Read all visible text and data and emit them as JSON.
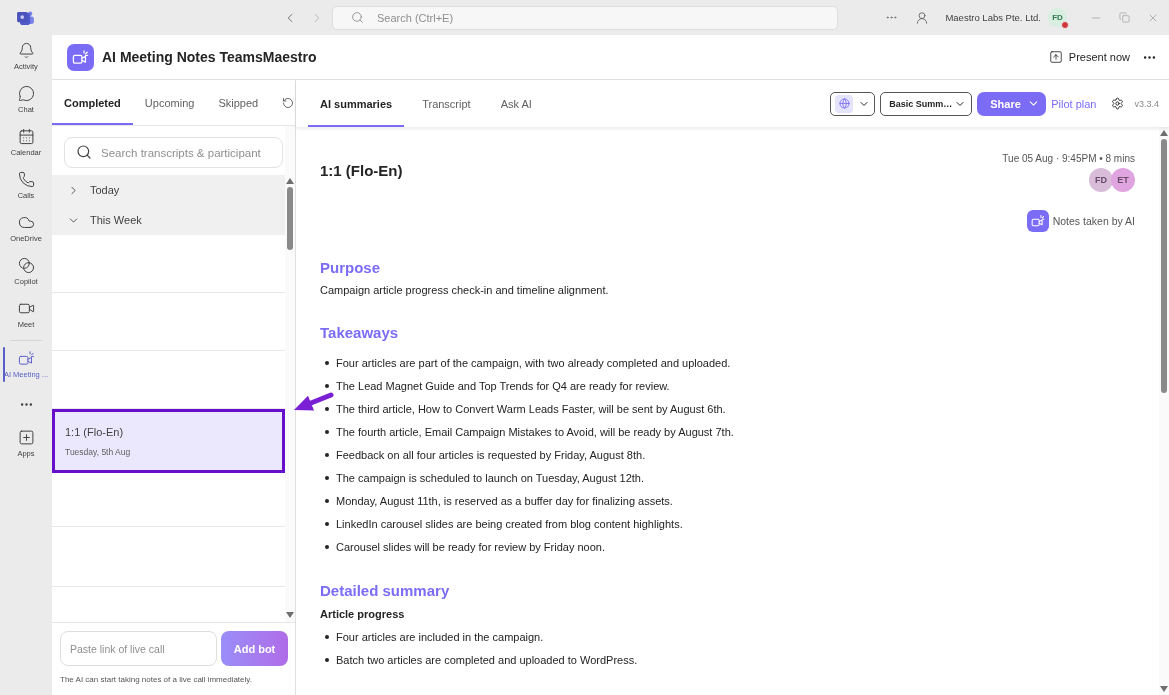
{
  "title_bar": {
    "search": {
      "placeholder": "Search (Ctrl+E)"
    },
    "organization": "Maestro Labs Pte. Ltd.",
    "user": {
      "initials": "FD"
    }
  },
  "rail": {
    "items": [
      {
        "label": "Activity",
        "selected": false
      },
      {
        "label": "Chat",
        "selected": false
      },
      {
        "label": "Calendar",
        "selected": false
      },
      {
        "label": "Calls",
        "selected": false
      },
      {
        "label": "OneDrive",
        "selected": false
      },
      {
        "label": "Copilot",
        "selected": false
      },
      {
        "label": "Meet",
        "selected": false
      },
      {
        "label": "AI Meeting ...",
        "selected": true
      }
    ],
    "apps": {
      "label": "Apps"
    }
  },
  "header": {
    "title": "AI Meeting Notes TeamsMaestro",
    "present_button": "Present now"
  },
  "left_panel": {
    "tabs": [
      {
        "label": "Completed",
        "selected": true
      },
      {
        "label": "Upcoming",
        "selected": false
      },
      {
        "label": "Skipped",
        "selected": false
      }
    ],
    "search": {
      "placeholder": "Search transcripts & participant"
    },
    "groups": [
      {
        "label": "Today",
        "expanded": false
      },
      {
        "label": "This Week",
        "expanded": true
      }
    ],
    "meetings": [
      {
        "title": "1:1 (Flo-En)",
        "date": "Tuesday, 5th Aug",
        "selected": true
      }
    ],
    "live_call": {
      "placeholder": "Paste link of live call",
      "button": "Add bot",
      "hint": "The AI can start taking notes of a live call immediately."
    }
  },
  "content": {
    "tabs": [
      {
        "label": "AI summaries",
        "selected": true
      },
      {
        "label": "Transcript",
        "selected": false
      },
      {
        "label": "Ask AI",
        "selected": false
      }
    ],
    "toolbar": {
      "template": "Basic Summ…",
      "share": "Share",
      "plan_link": "Pilot plan",
      "version": "v3.3.4"
    },
    "summary": {
      "title": "1:1 (Flo-En)",
      "meta": "Tue 05 Aug · 9:45PM • 8 mins",
      "participants": [
        {
          "initials": "FD",
          "color": "#d8bcd8"
        },
        {
          "initials": "ET",
          "color": "#e0a4e0"
        }
      ],
      "notes_badge": "Notes taken by AI",
      "sections": [
        {
          "heading": "Purpose",
          "blocks": [
            {
              "kind": "paragraph",
              "text": "Campaign article progress check-in and timeline alignment."
            }
          ]
        },
        {
          "heading": "Takeaways",
          "blocks": [
            {
              "kind": "bullets",
              "items": [
                "Four articles are part of the campaign, with two already completed and uploaded.",
                "The Lead Magnet Guide and Top Trends for Q4 are ready for review.",
                "The third article, How to Convert Warm Leads Faster, will be sent by August 6th.",
                "The fourth article, Email Campaign Mistakes to Avoid, will be ready by August 7th.",
                "Feedback on all four articles is requested by Friday, August 8th.",
                "The campaign is scheduled to launch on Tuesday, August 12th.",
                "Monday, August 11th, is reserved as a buffer day for finalizing assets.",
                "LinkedIn carousel slides are being created from blog content highlights.",
                "Carousel slides will be ready for review by Friday noon."
              ]
            }
          ]
        },
        {
          "heading": "Detailed summary",
          "blocks": [
            {
              "kind": "subheading",
              "text": "Article progress"
            },
            {
              "kind": "bullets",
              "items": [
                "Four articles are included in the campaign.",
                "Batch two articles are completed and uploaded to WordPress."
              ]
            }
          ]
        }
      ]
    }
  }
}
